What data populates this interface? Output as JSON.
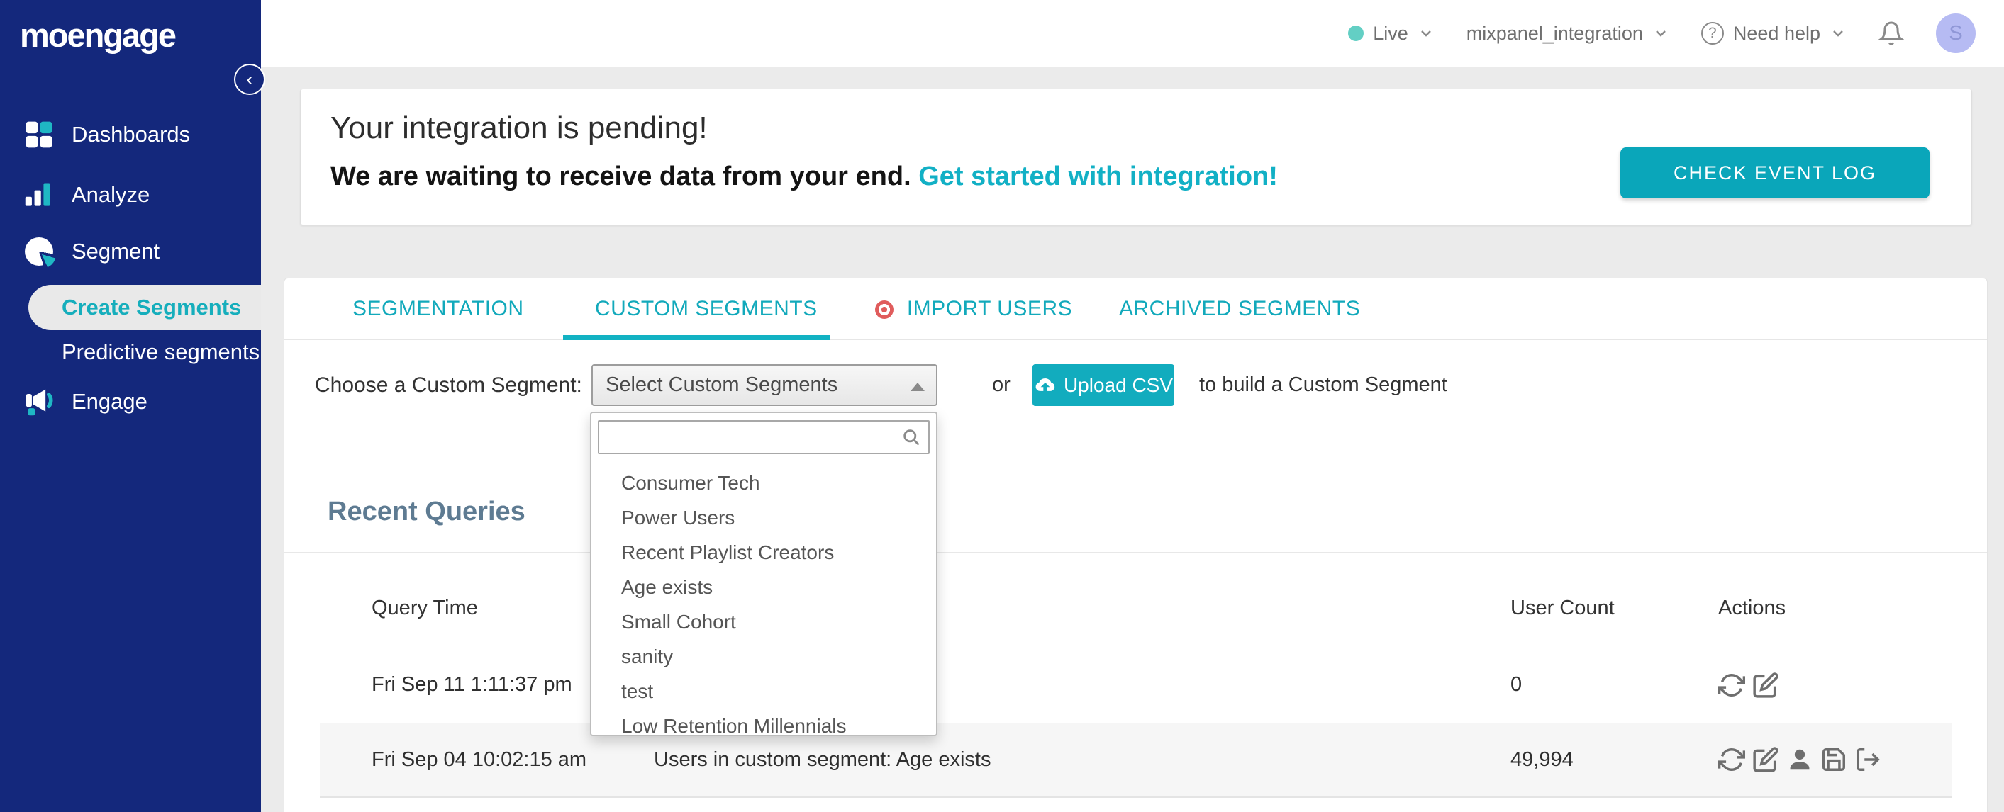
{
  "brand": {
    "logo_text": "moengage"
  },
  "topbar": {
    "environment": {
      "label": "Live"
    },
    "app_selector": {
      "label": "mixpanel_integration"
    },
    "help": {
      "label": "Need help",
      "icon_glyph": "?"
    },
    "avatar": {
      "initial": "S"
    }
  },
  "sidebar": {
    "collapse_glyph": "‹",
    "items": [
      {
        "label": "Dashboards"
      },
      {
        "label": "Analyze"
      },
      {
        "label": "Segment"
      },
      {
        "label": "Create Segments",
        "active": true
      },
      {
        "label": "Predictive segments"
      },
      {
        "label": "Engage"
      }
    ]
  },
  "banner": {
    "title": "Your integration is pending!",
    "message": "We are waiting to receive data from your end.",
    "link": "Get started with integration!",
    "button": "CHECK EVENT LOG"
  },
  "tabs": [
    {
      "label": "SEGMENTATION"
    },
    {
      "label": "CUSTOM SEGMENTS",
      "active": true
    },
    {
      "label": "IMPORT USERS",
      "badge": "red-dot"
    },
    {
      "label": "ARCHIVED SEGMENTS"
    }
  ],
  "segment_chooser": {
    "label": "Choose a Custom Segment:",
    "select_value": "Select Custom Segments",
    "or_text": "or",
    "upload_button": "Upload CSV",
    "suffix_text": "to build a Custom Segment",
    "search": {
      "value": "",
      "placeholder": ""
    },
    "dropdown_options": [
      "Consumer Tech",
      "Power Users",
      "Recent Playlist Creators",
      "Age exists",
      "Small Cohort",
      "sanity",
      "test",
      "Low Retention Millennials"
    ]
  },
  "recent_queries": {
    "title": "Recent Queries",
    "columns": {
      "time": "Query Time",
      "user_count": "User Count",
      "actions": "Actions"
    },
    "rows": [
      {
        "time": "Fri Sep 11 1:11:37 pm",
        "description": "",
        "user_count": "0",
        "action_icons": [
          "refresh",
          "edit"
        ]
      },
      {
        "time": "Fri Sep 04 10:02:15 am",
        "description": "Users in custom segment: Age exists",
        "user_count": "49,994",
        "action_icons": [
          "refresh",
          "edit",
          "user",
          "save",
          "export"
        ]
      }
    ]
  },
  "colors": {
    "sidebar_navy": "#14287c",
    "teal_accent": "#12acbe",
    "button_teal": "#0aa6ba",
    "live_dot": "#63cfc4",
    "avatar_bg": "#b6bbf3",
    "heading_slate": "#5e7b92",
    "import_dot_red": "#e05c5c",
    "row_alt_bg": "#f6f6f6"
  }
}
